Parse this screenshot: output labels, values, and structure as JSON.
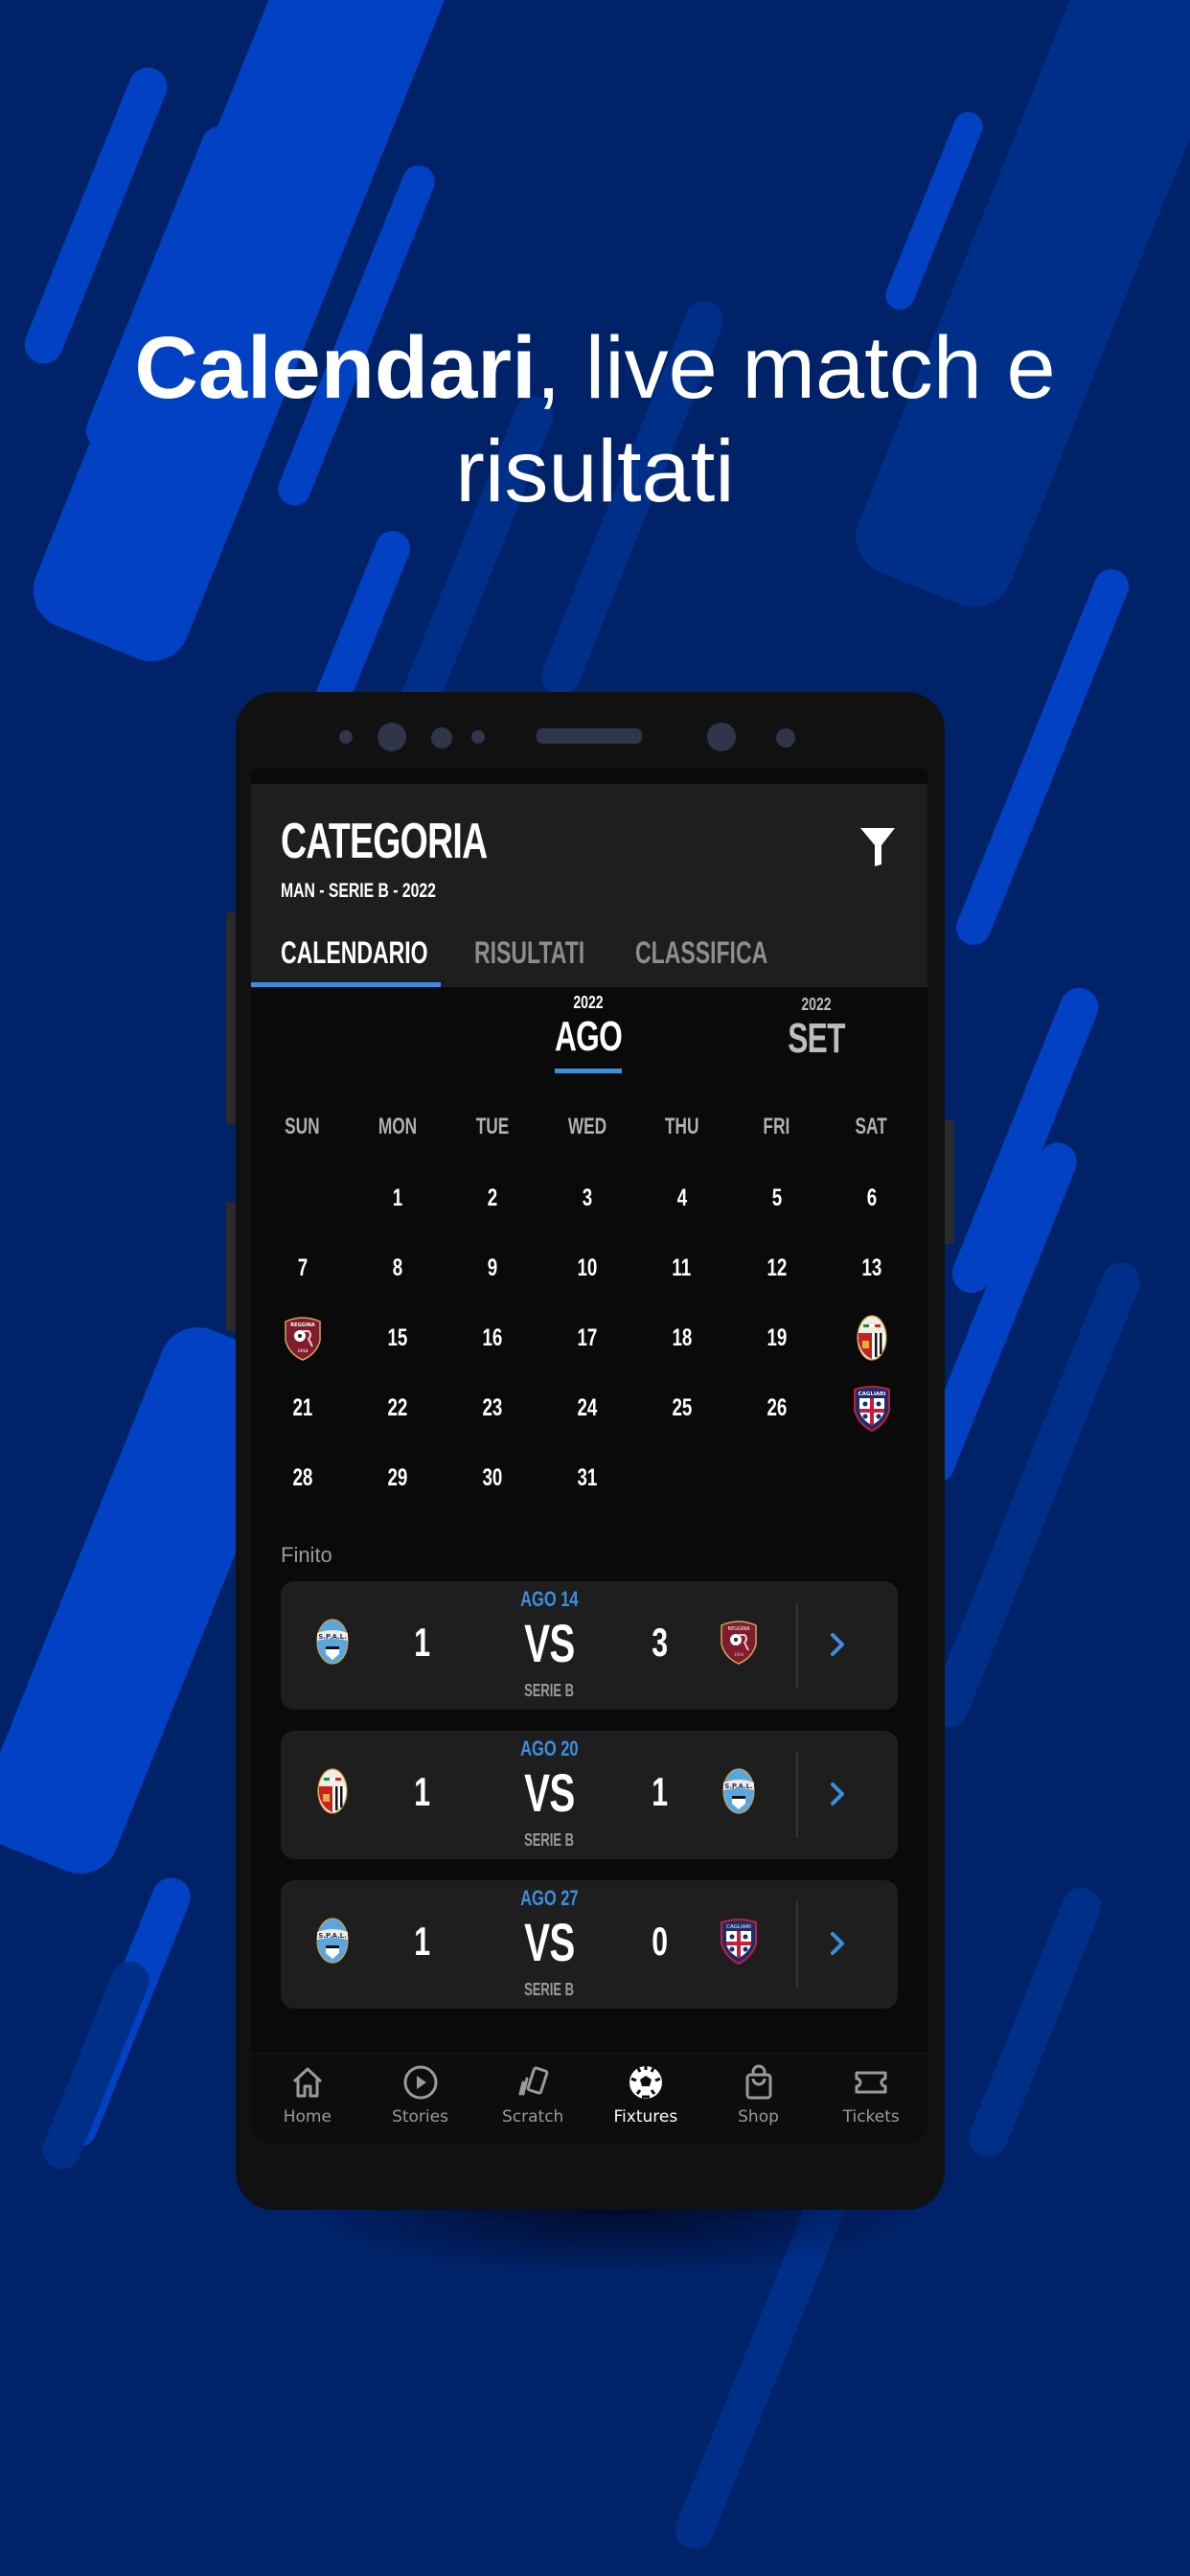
{
  "headline": {
    "bold": "Calendari",
    "regular_line1": ", live match e",
    "line2": "risultati"
  },
  "app_bar": {
    "title": "CATEGORIA",
    "subtitle": "MAN - SERIE B - 2022",
    "filter_icon": "filter-icon"
  },
  "tabs": [
    {
      "label": "CALENDARIO",
      "active": true
    },
    {
      "label": "RISULTATI",
      "active": false
    },
    {
      "label": "CLASSIFICA",
      "active": false
    }
  ],
  "months": [
    {
      "year": "2022",
      "label": "AGO",
      "active": true
    },
    {
      "year": "2022",
      "label": "SET",
      "active": false
    }
  ],
  "calendar": {
    "weekdays": [
      "SUN",
      "MON",
      "TUE",
      "WED",
      "THU",
      "FRI",
      "SAT"
    ],
    "weeks": [
      [
        "",
        "1",
        "2",
        "3",
        "4",
        "5",
        "6"
      ],
      [
        "7",
        "8",
        "9",
        "10",
        "11",
        "12",
        "13"
      ],
      [
        "crest:reggina",
        "15",
        "16",
        "17",
        "18",
        "19",
        "crest:ascoli"
      ],
      [
        "21",
        "22",
        "23",
        "24",
        "25",
        "26",
        "crest:cagliari"
      ],
      [
        "28",
        "29",
        "30",
        "31",
        "",
        "",
        ""
      ]
    ],
    "match_days": [
      {
        "day": "14",
        "team": "Reggina"
      },
      {
        "day": "20",
        "team": "Ascoli"
      },
      {
        "day": "27",
        "team": "Cagliari"
      }
    ]
  },
  "results_section": {
    "label": "Finito",
    "vs_label": "VS",
    "matches": [
      {
        "date": "AGO 14",
        "home_team": "SPAL",
        "home_crest": "spal",
        "home_score": "1",
        "away_team": "Reggina",
        "away_crest": "reggina",
        "away_score": "3",
        "league": "SERIE B"
      },
      {
        "date": "AGO 20",
        "home_team": "Ascoli",
        "home_crest": "ascoli",
        "home_score": "1",
        "away_team": "SPAL",
        "away_crest": "spal",
        "away_score": "1",
        "league": "SERIE B"
      },
      {
        "date": "AGO 27",
        "home_team": "SPAL",
        "home_crest": "spal",
        "home_score": "1",
        "away_team": "Cagliari",
        "away_crest": "cagliari",
        "away_score": "0",
        "league": "SERIE B"
      }
    ]
  },
  "bottom_nav": [
    {
      "label": "Home",
      "icon": "home-icon",
      "active": false
    },
    {
      "label": "Stories",
      "icon": "play-circle-icon",
      "active": false
    },
    {
      "label": "Scratch",
      "icon": "scratch-cards-icon",
      "active": false
    },
    {
      "label": "Fixtures",
      "icon": "soccer-ball-icon",
      "active": true
    },
    {
      "label": "Shop",
      "icon": "shopping-bag-icon",
      "active": false
    },
    {
      "label": "Tickets",
      "icon": "ticket-icon",
      "active": false
    }
  ],
  "colors": {
    "background": "#002269",
    "stripe_bright": "#0341c4",
    "accent": "#3e8ee0",
    "surface": "#1e1e1e",
    "screen_bg": "#0a0a0a"
  }
}
